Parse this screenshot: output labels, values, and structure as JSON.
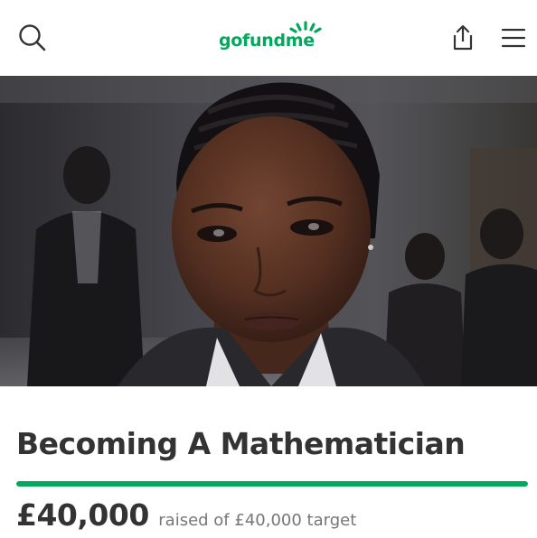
{
  "header": {
    "logo_text": "gofundme",
    "search_icon": "search-icon",
    "share_icon": "share-icon",
    "menu_icon": "menu-icon"
  },
  "hero": {
    "watermark": "",
    "image_subject": "portrait photo"
  },
  "campaign": {
    "title": "Becoming A Mathematician",
    "raised_amount": "£40,000",
    "raised_label": "raised of £40,000 target",
    "progress_fraction": 1.0
  },
  "colors": {
    "brand": "#02a95c",
    "text": "#333333",
    "muted": "#767676"
  }
}
